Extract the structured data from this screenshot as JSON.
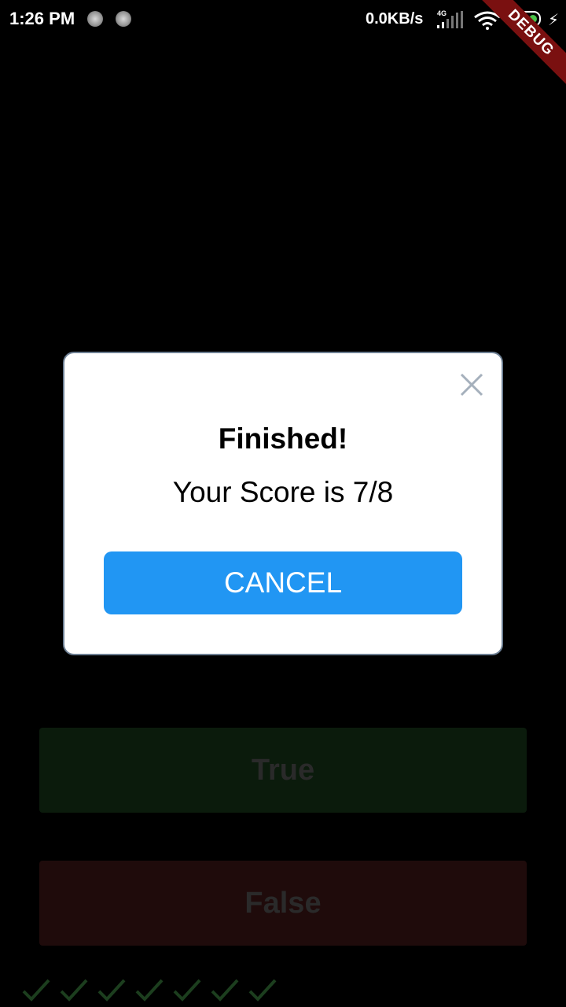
{
  "status_bar": {
    "time": "1:26 PM",
    "network_speed": "0.0KB/s",
    "network_type": "4G",
    "battery_level": "24",
    "icons": [
      "notification-icon",
      "notification-icon",
      "signal-icon",
      "wifi-icon",
      "battery-icon",
      "charging-icon"
    ]
  },
  "debug_banner": {
    "label": "DEBUG",
    "color": "#7a1010"
  },
  "dialog": {
    "title": "Finished!",
    "description": "Your Score is 7/8",
    "cancel_label": "CANCEL",
    "close_icon": "close-icon",
    "button_color": "#2196f3"
  },
  "quiz": {
    "true_label": "True",
    "false_label": "False",
    "score_keeper": [
      "check-icon",
      "check-icon",
      "check-icon",
      "check-icon",
      "check-icon",
      "check-icon",
      "check-icon"
    ]
  }
}
